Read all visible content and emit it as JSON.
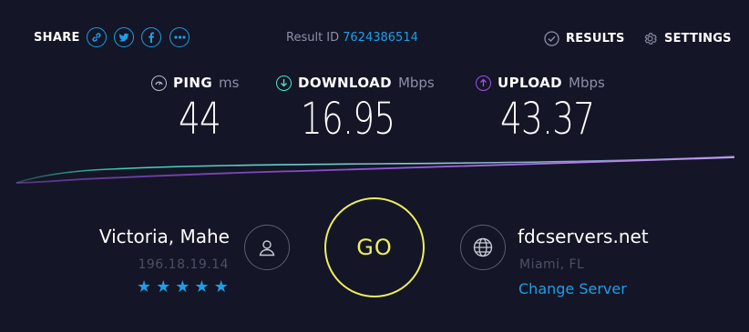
{
  "header": {
    "share_label": "SHARE",
    "share_icons": [
      "link-icon",
      "twitter-icon",
      "facebook-icon",
      "more-icon"
    ],
    "result_id_label": "Result ID",
    "result_id_value": "7624386514",
    "results_label": "RESULTS",
    "settings_label": "SETTINGS"
  },
  "metrics": {
    "ping": {
      "label": "PING",
      "unit": "ms",
      "value": "44",
      "icon": "ping-gauge-icon"
    },
    "download": {
      "label": "DOWNLOAD",
      "unit": "Mbps",
      "value": "16.95",
      "icon": "download-arrow-icon"
    },
    "upload": {
      "label": "UPLOAD",
      "unit": "Mbps",
      "value": "43.37",
      "icon": "upload-arrow-icon"
    }
  },
  "isp": {
    "name": "Victoria, Mahe",
    "ip": "196.18.19.14",
    "rating_stars": 5,
    "icon": "user-icon"
  },
  "go_label": "GO",
  "server": {
    "name": "fdcservers.net",
    "location": "Miami, FL",
    "change_label": "Change Server",
    "icon": "globe-icon"
  },
  "colors": {
    "background": "#141526",
    "accent_blue": "#1d9fe6",
    "download_cyan": "#43e8c9",
    "upload_purple": "#9b55e6",
    "go_yellow": "#eef05b",
    "muted": "#8d8fa6"
  }
}
